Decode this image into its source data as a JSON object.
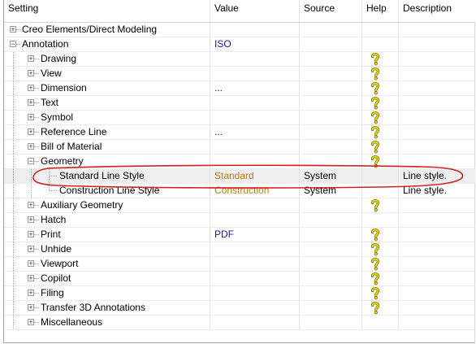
{
  "columns": {
    "setting": "Setting",
    "value": "Value",
    "source": "Source",
    "help": "Help",
    "description": "Description"
  },
  "rows": [
    {
      "label": "Creo Elements/Direct Modeling",
      "value": "",
      "source": "",
      "help": false,
      "description": "",
      "level": 0
    },
    {
      "label": "Annotation",
      "value": "ISO",
      "source": "",
      "help": false,
      "description": "",
      "level": 0
    },
    {
      "label": "Drawing",
      "value": "",
      "source": "",
      "help": true,
      "description": "",
      "level": 1
    },
    {
      "label": "View",
      "value": "",
      "source": "",
      "help": true,
      "description": "",
      "level": 1
    },
    {
      "label": "Dimension",
      "value": "...",
      "source": "",
      "help": true,
      "description": "",
      "level": 1
    },
    {
      "label": "Text",
      "value": "",
      "source": "",
      "help": true,
      "description": "",
      "level": 1
    },
    {
      "label": "Symbol",
      "value": "",
      "source": "",
      "help": true,
      "description": "",
      "level": 1
    },
    {
      "label": "Reference Line",
      "value": "...",
      "source": "",
      "help": true,
      "description": "",
      "level": 1
    },
    {
      "label": "Bill of Material",
      "value": "",
      "source": "",
      "help": true,
      "description": "",
      "level": 1
    },
    {
      "label": "Geometry",
      "value": "",
      "source": "",
      "help": true,
      "description": "",
      "level": 1
    },
    {
      "label": "Standard Line Style",
      "value": "Standard",
      "source": "System",
      "help": false,
      "description": "Line style.",
      "level": 2
    },
    {
      "label": "Construction Line Style",
      "value": "Construction",
      "source": "System",
      "help": false,
      "description": "Line style.",
      "level": 2
    },
    {
      "label": "Auxiliary Geometry",
      "value": "",
      "source": "",
      "help": true,
      "description": "",
      "level": 1
    },
    {
      "label": "Hatch",
      "value": "",
      "source": "",
      "help": false,
      "description": "",
      "level": 1
    },
    {
      "label": "Print",
      "value": "PDF",
      "source": "",
      "help": true,
      "description": "",
      "level": 1
    },
    {
      "label": "Unhide",
      "value": "",
      "source": "",
      "help": true,
      "description": "",
      "level": 1
    },
    {
      "label": "Viewport",
      "value": "",
      "source": "",
      "help": true,
      "description": "",
      "level": 1
    },
    {
      "label": "Copilot",
      "value": "",
      "source": "",
      "help": true,
      "description": "",
      "level": 1
    },
    {
      "label": "Filing",
      "value": "",
      "source": "",
      "help": true,
      "description": "",
      "level": 1
    },
    {
      "label": "Transfer 3D Annotations",
      "value": "",
      "source": "",
      "help": true,
      "description": "",
      "level": 1
    },
    {
      "label": "Miscellaneous",
      "value": "",
      "source": "",
      "help": false,
      "description": "",
      "level": 1
    }
  ],
  "colors": {
    "value_blue": "#1a1aa6",
    "value_orange": "#c77a10",
    "help_yellow": "#f2e400",
    "annotation_red": "#d42020"
  },
  "icons": {
    "help": "question-mark-help-icon",
    "expand": "plus-box-icon",
    "collapse": "minus-box-icon"
  },
  "selected_row": "Standard Line Style",
  "highlight": "Standard Line Style"
}
